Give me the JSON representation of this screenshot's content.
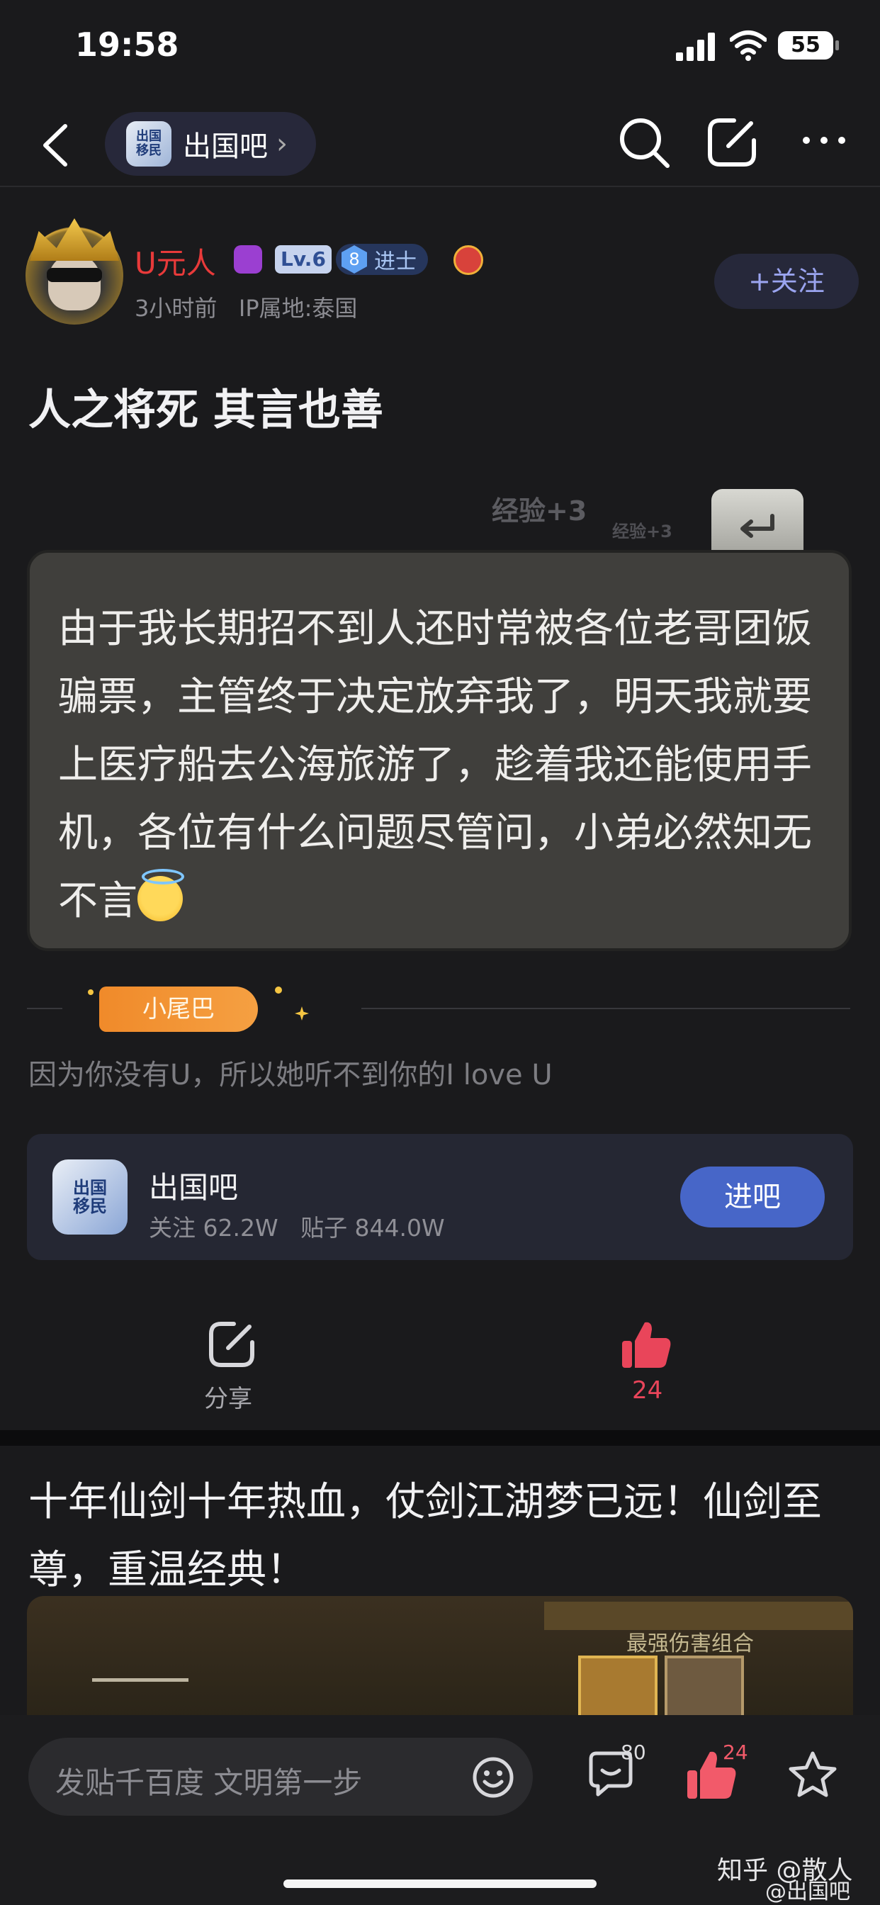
{
  "status": {
    "time": "19:58",
    "battery": "55"
  },
  "nav": {
    "bar_name": "出国吧",
    "chevron": "›",
    "logo_text": "出国\n移民"
  },
  "post": {
    "author": "U元人",
    "level": "Lv.6",
    "rank_num": "8",
    "rank_title": "进士",
    "meta": "3小时前   IP属地:泰国",
    "follow_label": "+关注",
    "title": "人之将死 其言也善",
    "exp_big": "经验+3",
    "exp_small": "经验+3",
    "body": "由于我长期招不到人还时常被各位老哥团饭骗票，主管终于决定放弃我了，明天我就要上医疗船去公海旅游了，趁着我还能使用手机，各位有什么问题尽管问，小弟必然知无不言",
    "tail_label": "小尾巴",
    "signature": "因为你没有U，所以她听不到你的I love U"
  },
  "forum_card": {
    "name": "出国吧",
    "stats": "关注 62.2W   贴子 844.0W",
    "enter_label": "进吧",
    "logo_text": "出国\n移民"
  },
  "actions": {
    "share_label": "分享",
    "like_count": "24"
  },
  "ad": {
    "title": "十年仙剑十年热血，仗剑江湖梦已远！仙剑至尊，重温经典！",
    "subtitle": "最强伤害组合"
  },
  "bottom": {
    "input_placeholder": "发贴千百度 文明第一步",
    "comment_count": "80",
    "like_count": "24",
    "watermark": "知乎 @散人",
    "watermark_sub": "@出国吧"
  },
  "colors": {
    "accent_blue": "#4766c8",
    "like_red": "#e9455a",
    "username_red": "#e83a3a"
  }
}
